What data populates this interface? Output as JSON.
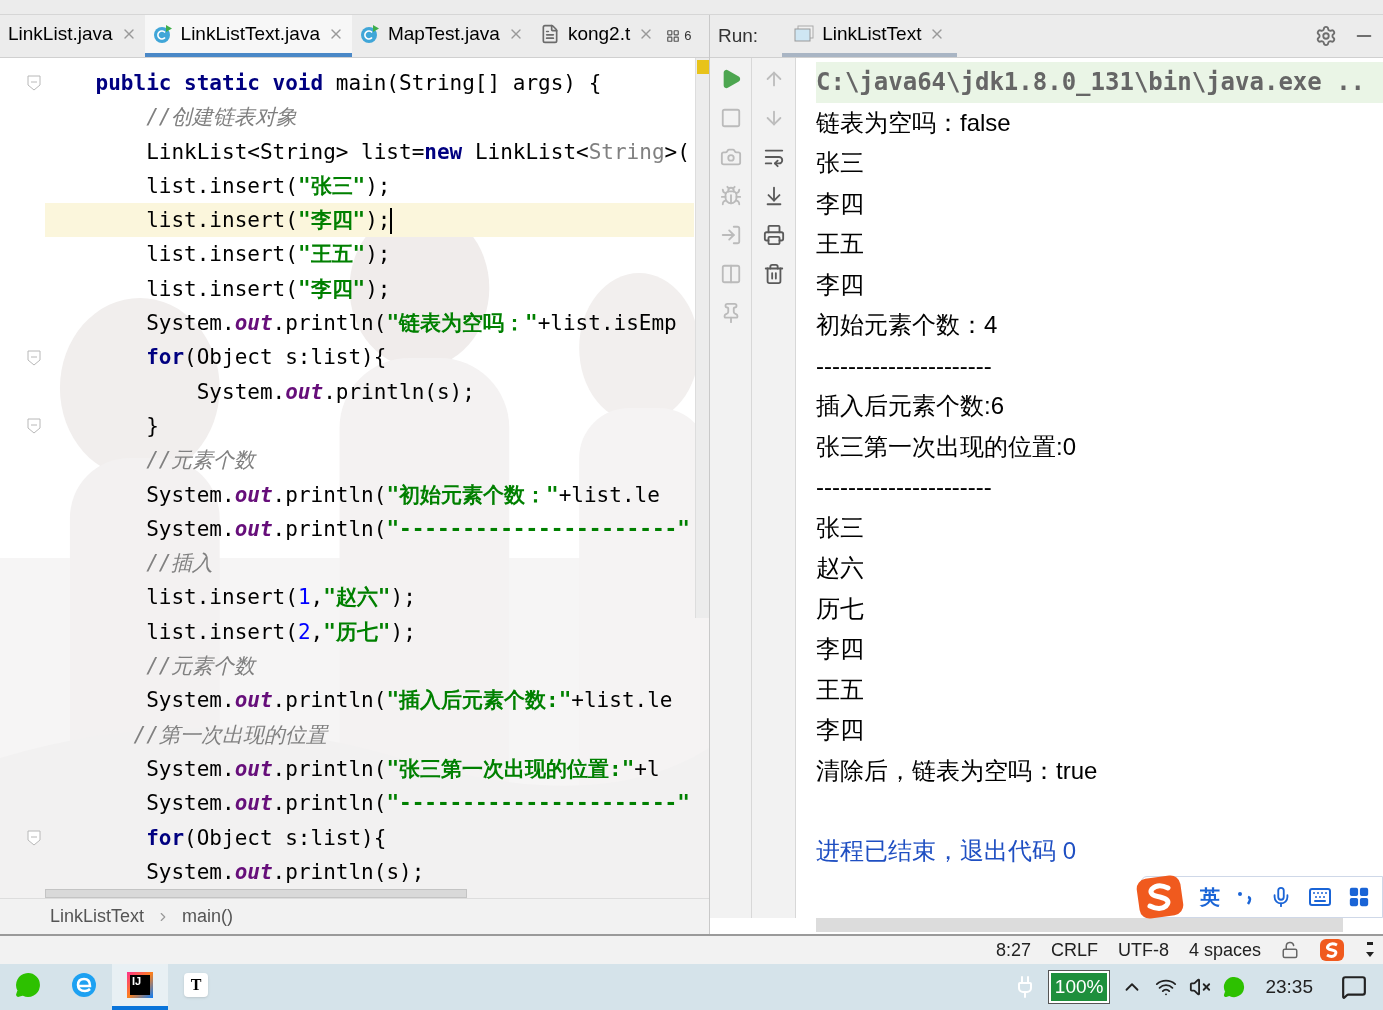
{
  "editor": {
    "tabs": [
      {
        "label": "LinkList.java",
        "selected": false
      },
      {
        "label": "LinkListText.java",
        "kind": "class",
        "selected": true
      },
      {
        "label": "MapTest.java",
        "kind": "class",
        "selected": false
      },
      {
        "label": "kong2.t",
        "kind": "file",
        "selected": false
      }
    ],
    "overflow_count": "6",
    "code_lines": [
      {
        "current": false,
        "fold": true,
        "tokens": [
          {
            "t": "    public static void",
            "kind": "keyword"
          },
          {
            "t": " main(String[] args) {",
            "kind": "plain"
          }
        ]
      },
      {
        "current": false,
        "fold": false,
        "tokens": [
          {
            "t": "        //创建链表对象",
            "kind": "comment"
          }
        ]
      },
      {
        "current": false,
        "fold": false,
        "tokens": [
          {
            "t": "        LinkList<String> list=",
            "kind": "plain"
          },
          {
            "t": "new",
            "kind": "keyword"
          },
          {
            "t": " LinkList<",
            "kind": "plain"
          },
          {
            "t": "String",
            "kind": "inferred"
          },
          {
            "t": ">(",
            "kind": "plain"
          }
        ]
      },
      {
        "current": false,
        "fold": false,
        "tokens": [
          {
            "t": "        list.insert(",
            "kind": "plain"
          },
          {
            "t": "\"张三\"",
            "kind": "string"
          },
          {
            "t": ");",
            "kind": "plain"
          }
        ]
      },
      {
        "current": true,
        "fold": false,
        "tokens": [
          {
            "t": "        list.insert(",
            "kind": "plain"
          },
          {
            "t": "\"李四\"",
            "kind": "string"
          },
          {
            "t": ");",
            "kind": "plain"
          }
        ]
      },
      {
        "current": false,
        "fold": false,
        "tokens": [
          {
            "t": "        list.insert(",
            "kind": "plain"
          },
          {
            "t": "\"王五\"",
            "kind": "string"
          },
          {
            "t": ");",
            "kind": "plain"
          }
        ]
      },
      {
        "current": false,
        "fold": false,
        "tokens": [
          {
            "t": "        list.insert(",
            "kind": "plain"
          },
          {
            "t": "\"李四\"",
            "kind": "string"
          },
          {
            "t": ");",
            "kind": "plain"
          }
        ]
      },
      {
        "current": false,
        "fold": false,
        "tokens": [
          {
            "t": "        System.",
            "kind": "plain"
          },
          {
            "t": "out",
            "kind": "field"
          },
          {
            "t": ".println(",
            "kind": "plain"
          },
          {
            "t": "\"链表为空吗：\"",
            "kind": "string"
          },
          {
            "t": "+list.isEmp",
            "kind": "plain"
          }
        ]
      },
      {
        "current": false,
        "fold": true,
        "tokens": [
          {
            "t": "        for",
            "kind": "keyword"
          },
          {
            "t": "(Object s:list){",
            "kind": "plain"
          }
        ]
      },
      {
        "current": false,
        "fold": false,
        "tokens": [
          {
            "t": "            System.",
            "kind": "plain"
          },
          {
            "t": "out",
            "kind": "field"
          },
          {
            "t": ".println(s);",
            "kind": "plain"
          }
        ]
      },
      {
        "current": false,
        "fold": true,
        "tokens": [
          {
            "t": "        }",
            "kind": "plain"
          }
        ]
      },
      {
        "current": false,
        "fold": false,
        "tokens": [
          {
            "t": "        //元素个数",
            "kind": "comment"
          }
        ]
      },
      {
        "current": false,
        "fold": false,
        "tokens": [
          {
            "t": "        System.",
            "kind": "plain"
          },
          {
            "t": "out",
            "kind": "field"
          },
          {
            "t": ".println(",
            "kind": "plain"
          },
          {
            "t": "\"初始元素个数：\"",
            "kind": "string"
          },
          {
            "t": "+list.le",
            "kind": "plain"
          }
        ]
      },
      {
        "current": false,
        "fold": false,
        "tokens": [
          {
            "t": "        System.",
            "kind": "plain"
          },
          {
            "t": "out",
            "kind": "field"
          },
          {
            "t": ".println(",
            "kind": "plain"
          },
          {
            "t": "\"----------------------\"",
            "kind": "string"
          }
        ]
      },
      {
        "current": false,
        "fold": false,
        "tokens": [
          {
            "t": "        //插入",
            "kind": "comment"
          }
        ]
      },
      {
        "current": false,
        "fold": false,
        "tokens": [
          {
            "t": "        list.insert(",
            "kind": "plain"
          },
          {
            "t": "1",
            "kind": "number"
          },
          {
            "t": ",",
            "kind": "plain"
          },
          {
            "t": "\"赵六\"",
            "kind": "string"
          },
          {
            "t": ");",
            "kind": "plain"
          }
        ]
      },
      {
        "current": false,
        "fold": false,
        "tokens": [
          {
            "t": "        list.insert(",
            "kind": "plain"
          },
          {
            "t": "2",
            "kind": "number"
          },
          {
            "t": ",",
            "kind": "plain"
          },
          {
            "t": "\"历七\"",
            "kind": "string"
          },
          {
            "t": ");",
            "kind": "plain"
          }
        ]
      },
      {
        "current": false,
        "fold": false,
        "tokens": [
          {
            "t": "        //元素个数",
            "kind": "comment"
          }
        ]
      },
      {
        "current": false,
        "fold": false,
        "tokens": [
          {
            "t": "        System.",
            "kind": "plain"
          },
          {
            "t": "out",
            "kind": "field"
          },
          {
            "t": ".println(",
            "kind": "plain"
          },
          {
            "t": "\"插入后元素个数:\"",
            "kind": "string"
          },
          {
            "t": "+list.le",
            "kind": "plain"
          }
        ]
      },
      {
        "current": false,
        "fold": false,
        "tokens": [
          {
            "t": "       //第一次出现的位置",
            "kind": "comment"
          }
        ]
      },
      {
        "current": false,
        "fold": false,
        "tokens": [
          {
            "t": "        System.",
            "kind": "plain"
          },
          {
            "t": "out",
            "kind": "field"
          },
          {
            "t": ".println(",
            "kind": "plain"
          },
          {
            "t": "\"张三第一次出现的位置:\"",
            "kind": "string"
          },
          {
            "t": "+l",
            "kind": "plain"
          }
        ]
      },
      {
        "current": false,
        "fold": false,
        "tokens": [
          {
            "t": "        System.",
            "kind": "plain"
          },
          {
            "t": "out",
            "kind": "field"
          },
          {
            "t": ".println(",
            "kind": "plain"
          },
          {
            "t": "\"----------------------\"",
            "kind": "string"
          }
        ]
      },
      {
        "current": false,
        "fold": true,
        "tokens": [
          {
            "t": "        for",
            "kind": "keyword"
          },
          {
            "t": "(Object s:list){",
            "kind": "plain"
          }
        ]
      },
      {
        "current": false,
        "fold": false,
        "tokens": [
          {
            "t": "        System.",
            "kind": "plain"
          },
          {
            "t": "out",
            "kind": "field"
          },
          {
            "t": ".println(s);",
            "kind": "plain"
          }
        ]
      }
    ],
    "breadcrumb": [
      "LinkListText",
      "main()"
    ]
  },
  "run_panel": {
    "label": "Run:",
    "tab": "LinkListText",
    "console": [
      {
        "kind": "command",
        "text": "C:\\java64\\jdk1.8.0_131\\bin\\java.exe .."
      },
      {
        "kind": "output",
        "text": "链表为空吗：false"
      },
      {
        "kind": "output",
        "text": "张三"
      },
      {
        "kind": "output",
        "text": "李四"
      },
      {
        "kind": "output",
        "text": "王五"
      },
      {
        "kind": "output",
        "text": "李四"
      },
      {
        "kind": "output",
        "text": "初始元素个数：4"
      },
      {
        "kind": "output",
        "text": "----------------------"
      },
      {
        "kind": "output",
        "text": "插入后元素个数:6"
      },
      {
        "kind": "output",
        "text": "张三第一次出现的位置:0"
      },
      {
        "kind": "output",
        "text": "----------------------"
      },
      {
        "kind": "output",
        "text": "张三"
      },
      {
        "kind": "output",
        "text": "赵六"
      },
      {
        "kind": "output",
        "text": "历七"
      },
      {
        "kind": "output",
        "text": "李四"
      },
      {
        "kind": "output",
        "text": "王五"
      },
      {
        "kind": "output",
        "text": "李四"
      },
      {
        "kind": "output",
        "text": "清除后，链表为空吗：true"
      },
      {
        "kind": "exit",
        "text": "进程已结束，退出代码 0"
      }
    ]
  },
  "ime_bar": {
    "mode": "英"
  },
  "status_bar": {
    "items": [
      "8:27",
      "CRLF",
      "UTF-8",
      "4 spaces"
    ]
  },
  "taskbar": {
    "apps": [
      {
        "kind": "chat",
        "selected": false
      },
      {
        "kind": "browser",
        "selected": false
      },
      {
        "kind": "ide",
        "label": "IJ",
        "selected": true
      },
      {
        "kind": "typora",
        "label": "T",
        "selected": false
      }
    ],
    "battery": "100%",
    "time": "23:35"
  }
}
